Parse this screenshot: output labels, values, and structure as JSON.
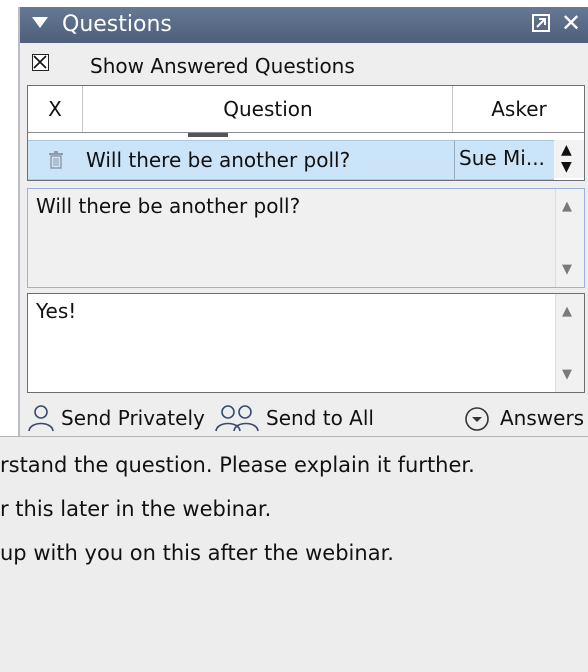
{
  "panel": {
    "title": "Questions",
    "show_answered_label": "Show Answered Questions",
    "show_answered_checked": true
  },
  "table": {
    "headers": {
      "x": "X",
      "question": "Question",
      "asker": "Asker"
    },
    "rows": [
      {
        "question": "Will there be another poll?",
        "asker": "Sue Mi..."
      }
    ]
  },
  "question_box": {
    "text": "Will there be another poll?"
  },
  "answer_box": {
    "text": "Yes!"
  },
  "actions": {
    "send_privately": "Send Privately",
    "send_to_all": "Send to All",
    "answers": "Answers"
  },
  "answers_menu": {
    "options": [
      "rstand the question. Please explain it further.",
      "r this later in the webinar.",
      " up with you on this after the webinar."
    ]
  },
  "colors": {
    "titlebar": "#5a6b88",
    "selected_row": "#cce4f7",
    "panel_bg": "#eeeeee"
  }
}
